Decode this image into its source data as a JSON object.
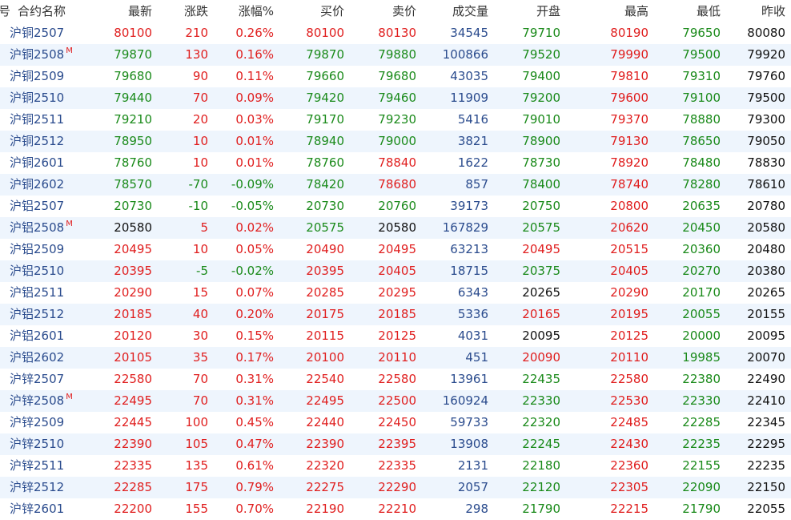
{
  "columns": [
    {
      "key": "idx",
      "label": "号"
    },
    {
      "key": "name",
      "label": "合约名称"
    },
    {
      "key": "last",
      "label": "最新"
    },
    {
      "key": "change",
      "label": "涨跌"
    },
    {
      "key": "pct",
      "label": "涨幅%"
    },
    {
      "key": "bid",
      "label": "买价"
    },
    {
      "key": "ask",
      "label": "卖价"
    },
    {
      "key": "volume",
      "label": "成交量"
    },
    {
      "key": "open",
      "label": "开盘"
    },
    {
      "key": "high",
      "label": "最高"
    },
    {
      "key": "low",
      "label": "最低"
    },
    {
      "key": "prev",
      "label": "昨收"
    }
  ],
  "colors": {
    "up": "#e01e1e",
    "down": "#1a8a1a",
    "flat": "#111111",
    "volume": "#2a4b8d",
    "name": "#2a4b8d",
    "row_alt": "#eef5fd"
  },
  "rows": [
    {
      "name": "沪铜2507",
      "mark": "",
      "last": "80100",
      "change": "210",
      "pct": "0.26%",
      "bid": "80100",
      "ask": "80130",
      "volume": "34545",
      "open": "79710",
      "high": "80190",
      "low": "79650",
      "prev": "80080"
    },
    {
      "name": "沪铜2508",
      "mark": "M",
      "last": "79870",
      "change": "130",
      "pct": "0.16%",
      "bid": "79870",
      "ask": "79880",
      "volume": "100866",
      "open": "79520",
      "high": "79990",
      "low": "79500",
      "prev": "79920"
    },
    {
      "name": "沪铜2509",
      "mark": "",
      "last": "79680",
      "change": "90",
      "pct": "0.11%",
      "bid": "79660",
      "ask": "79680",
      "volume": "43035",
      "open": "79400",
      "high": "79810",
      "low": "79310",
      "prev": "79760"
    },
    {
      "name": "沪铜2510",
      "mark": "",
      "last": "79440",
      "change": "70",
      "pct": "0.09%",
      "bid": "79420",
      "ask": "79460",
      "volume": "11909",
      "open": "79200",
      "high": "79600",
      "low": "79100",
      "prev": "79500"
    },
    {
      "name": "沪铜2511",
      "mark": "",
      "last": "79210",
      "change": "20",
      "pct": "0.03%",
      "bid": "79170",
      "ask": "79230",
      "volume": "5416",
      "open": "79010",
      "high": "79370",
      "low": "78880",
      "prev": "79300"
    },
    {
      "name": "沪铜2512",
      "mark": "",
      "last": "78950",
      "change": "10",
      "pct": "0.01%",
      "bid": "78940",
      "ask": "79000",
      "volume": "3821",
      "open": "78900",
      "high": "79130",
      "low": "78650",
      "prev": "79050"
    },
    {
      "name": "沪铜2601",
      "mark": "",
      "last": "78760",
      "change": "10",
      "pct": "0.01%",
      "bid": "78760",
      "ask": "78840",
      "volume": "1622",
      "open": "78730",
      "high": "78920",
      "low": "78480",
      "prev": "78830"
    },
    {
      "name": "沪铜2602",
      "mark": "",
      "last": "78570",
      "change": "-70",
      "pct": "-0.09%",
      "bid": "78420",
      "ask": "78680",
      "volume": "857",
      "open": "78400",
      "high": "78740",
      "low": "78280",
      "prev": "78610"
    },
    {
      "name": "沪铝2507",
      "mark": "",
      "last": "20730",
      "change": "-10",
      "pct": "-0.05%",
      "bid": "20730",
      "ask": "20760",
      "volume": "39173",
      "open": "20750",
      "high": "20800",
      "low": "20635",
      "prev": "20780"
    },
    {
      "name": "沪铝2508",
      "mark": "M",
      "last": "20580",
      "change": "5",
      "pct": "0.02%",
      "bid": "20575",
      "ask": "20580",
      "volume": "167829",
      "open": "20575",
      "high": "20620",
      "low": "20450",
      "prev": "20580"
    },
    {
      "name": "沪铝2509",
      "mark": "",
      "last": "20495",
      "change": "10",
      "pct": "0.05%",
      "bid": "20490",
      "ask": "20495",
      "volume": "63213",
      "open": "20495",
      "high": "20515",
      "low": "20360",
      "prev": "20480"
    },
    {
      "name": "沪铝2510",
      "mark": "",
      "last": "20395",
      "change": "-5",
      "pct": "-0.02%",
      "bid": "20395",
      "ask": "20405",
      "volume": "18715",
      "open": "20375",
      "high": "20405",
      "low": "20270",
      "prev": "20380"
    },
    {
      "name": "沪铝2511",
      "mark": "",
      "last": "20290",
      "change": "15",
      "pct": "0.07%",
      "bid": "20285",
      "ask": "20295",
      "volume": "6343",
      "open": "20265",
      "high": "20290",
      "low": "20170",
      "prev": "20265"
    },
    {
      "name": "沪铝2512",
      "mark": "",
      "last": "20185",
      "change": "40",
      "pct": "0.20%",
      "bid": "20175",
      "ask": "20185",
      "volume": "5336",
      "open": "20165",
      "high": "20195",
      "low": "20055",
      "prev": "20155"
    },
    {
      "name": "沪铝2601",
      "mark": "",
      "last": "20120",
      "change": "30",
      "pct": "0.15%",
      "bid": "20115",
      "ask": "20125",
      "volume": "4031",
      "open": "20095",
      "high": "20125",
      "low": "20000",
      "prev": "20095"
    },
    {
      "name": "沪铝2602",
      "mark": "",
      "last": "20105",
      "change": "35",
      "pct": "0.17%",
      "bid": "20100",
      "ask": "20110",
      "volume": "451",
      "open": "20090",
      "high": "20110",
      "low": "19985",
      "prev": "20070"
    },
    {
      "name": "沪锌2507",
      "mark": "",
      "last": "22580",
      "change": "70",
      "pct": "0.31%",
      "bid": "22540",
      "ask": "22580",
      "volume": "13961",
      "open": "22435",
      "high": "22580",
      "low": "22380",
      "prev": "22490"
    },
    {
      "name": "沪锌2508",
      "mark": "M",
      "last": "22495",
      "change": "70",
      "pct": "0.31%",
      "bid": "22495",
      "ask": "22500",
      "volume": "160924",
      "open": "22330",
      "high": "22530",
      "low": "22330",
      "prev": "22410"
    },
    {
      "name": "沪锌2509",
      "mark": "",
      "last": "22445",
      "change": "100",
      "pct": "0.45%",
      "bid": "22440",
      "ask": "22450",
      "volume": "59733",
      "open": "22320",
      "high": "22485",
      "low": "22285",
      "prev": "22345"
    },
    {
      "name": "沪锌2510",
      "mark": "",
      "last": "22390",
      "change": "105",
      "pct": "0.47%",
      "bid": "22390",
      "ask": "22395",
      "volume": "13908",
      "open": "22245",
      "high": "22430",
      "low": "22235",
      "prev": "22295"
    },
    {
      "name": "沪锌2511",
      "mark": "",
      "last": "22335",
      "change": "135",
      "pct": "0.61%",
      "bid": "22320",
      "ask": "22335",
      "volume": "2131",
      "open": "22180",
      "high": "22360",
      "low": "22155",
      "prev": "22235"
    },
    {
      "name": "沪锌2512",
      "mark": "",
      "last": "22285",
      "change": "175",
      "pct": "0.79%",
      "bid": "22275",
      "ask": "22290",
      "volume": "2057",
      "open": "22120",
      "high": "22305",
      "low": "22090",
      "prev": "22150"
    },
    {
      "name": "沪锌2601",
      "mark": "",
      "last": "22200",
      "change": "155",
      "pct": "0.70%",
      "bid": "22190",
      "ask": "22210",
      "volume": "298",
      "open": "21790",
      "high": "22215",
      "low": "21790",
      "prev": "22055"
    }
  ]
}
